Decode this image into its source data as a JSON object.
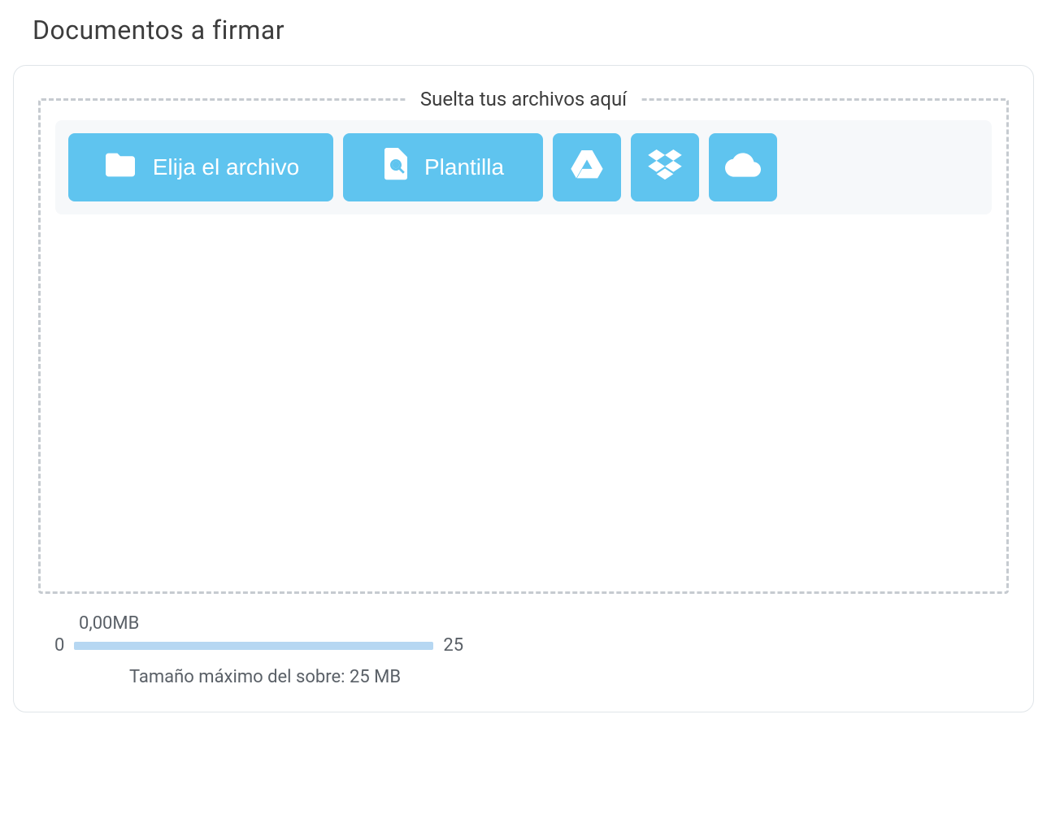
{
  "title": "Documentos a firmar",
  "dropzone": {
    "label": "Suelta tus archivos aquí",
    "buttons": {
      "choose_file": "Elija el archivo",
      "template": "Plantilla"
    }
  },
  "size": {
    "used_label": "0,00MB",
    "min": "0",
    "max": "25",
    "hint": "Tamaño máximo del sobre: 25 MB"
  }
}
